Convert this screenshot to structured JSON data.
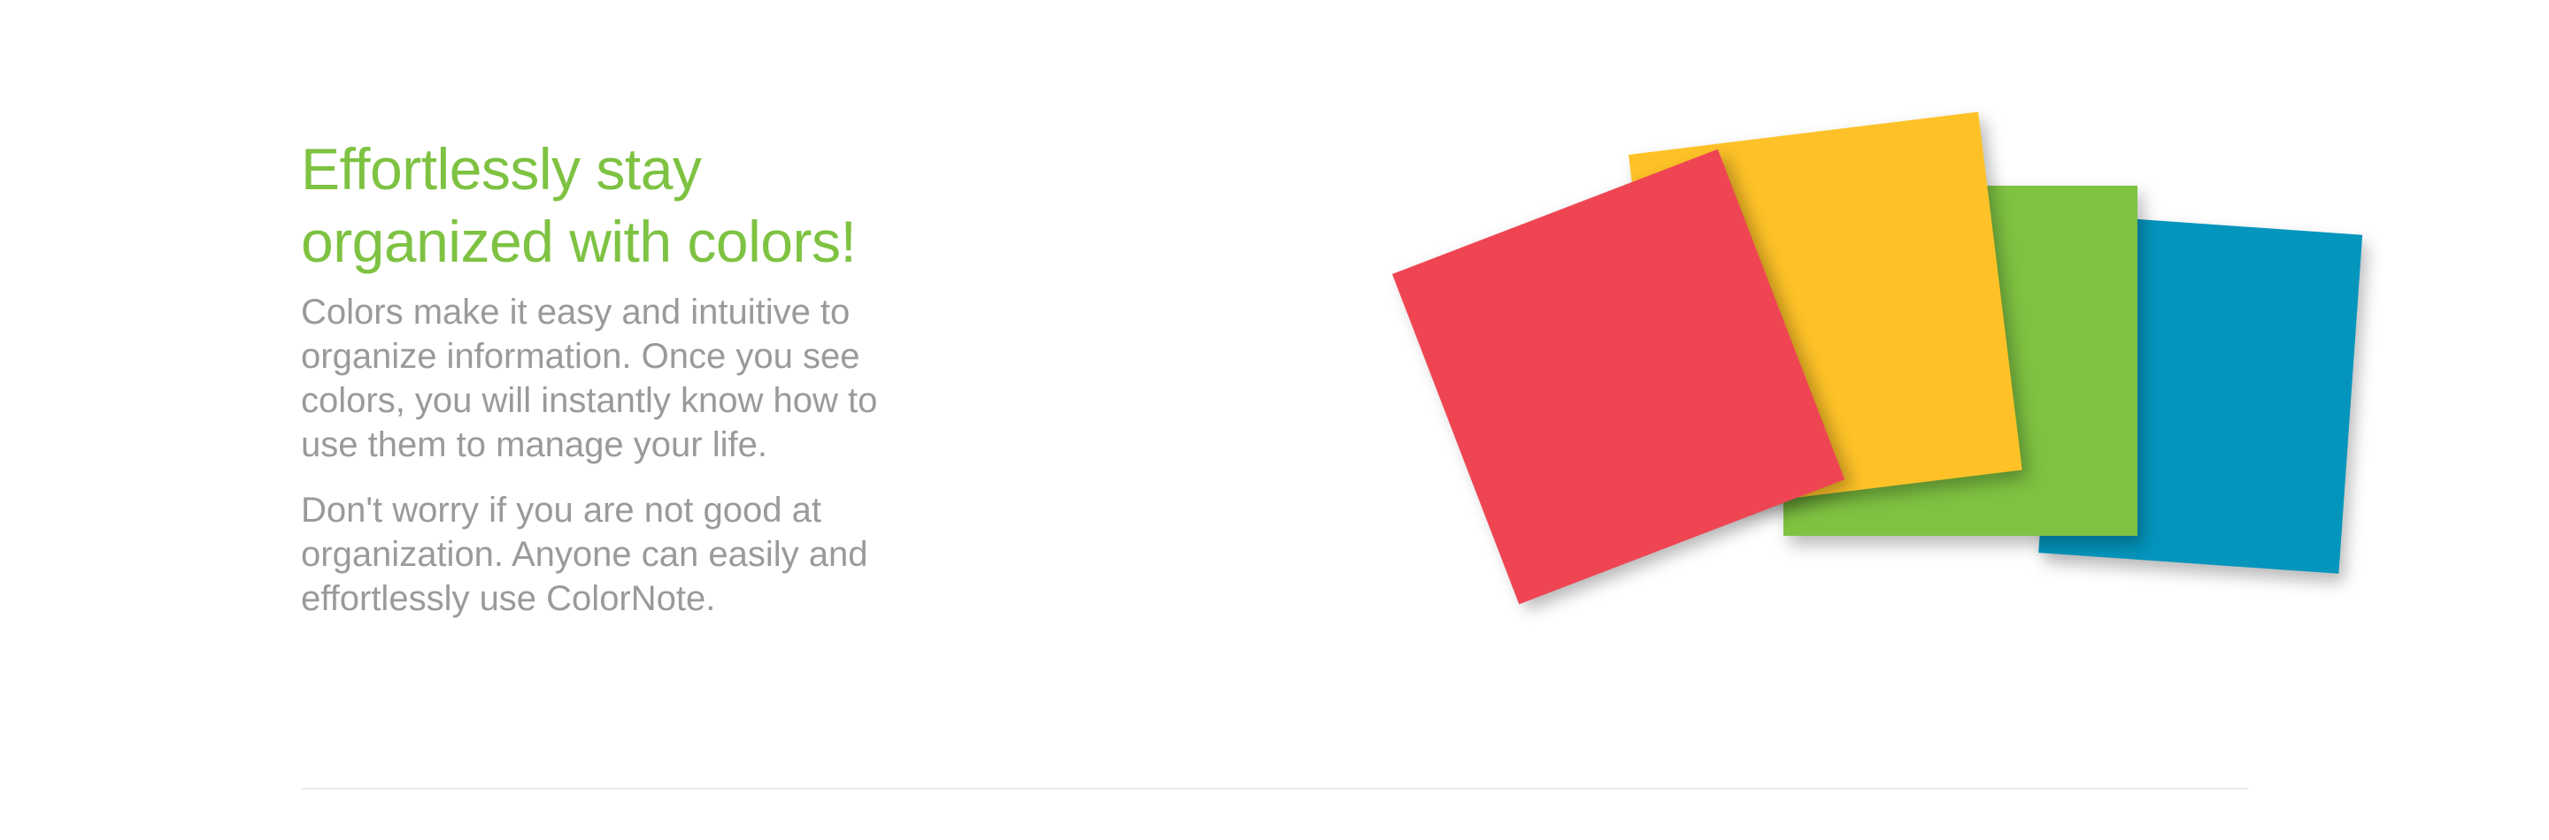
{
  "feature": {
    "heading_lines": [
      "Effortlessly stay",
      "organized with colors!"
    ],
    "paragraphs": [
      "Colors make it easy and intuitive to organize information. Once you see colors, you will instantly know how to use them to manage your life.",
      "Don't worry if you are not good at organization. Anyone can easily and effortlessly use ColorNote."
    ]
  },
  "illustration": {
    "note_colors": {
      "red": "#ef4553",
      "yellow": "#fec228",
      "green": "#7ec242",
      "blue": "#0495bd"
    }
  },
  "theme": {
    "heading_color": "#7ec242",
    "body_text_color": "#9a9a9a",
    "divider_color": "#ececec",
    "background": "#ffffff"
  }
}
